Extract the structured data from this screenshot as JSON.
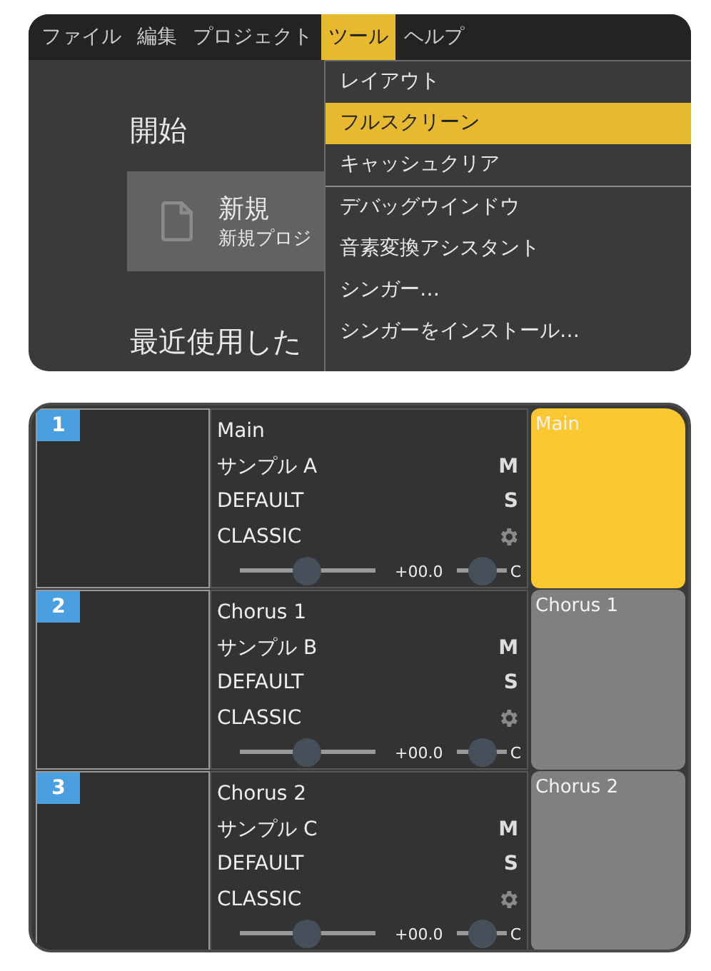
{
  "menu_bar": [
    {
      "label": "ファイル",
      "selected": false
    },
    {
      "label": "編集",
      "selected": false
    },
    {
      "label": "プロジェクト",
      "selected": false
    },
    {
      "label": "ツール",
      "selected": true
    },
    {
      "label": "ヘルプ",
      "selected": false
    }
  ],
  "start": {
    "heading": "開始",
    "new_card": {
      "title": "新規",
      "subtitle": "新規プロジ"
    },
    "recent_heading": "最近使用した"
  },
  "dropdown": [
    {
      "label": "レイアウト",
      "selected": false,
      "divider_after": false
    },
    {
      "label": "フルスクリーン",
      "selected": true,
      "divider_after": false
    },
    {
      "label": "キャッシュクリア",
      "selected": false,
      "divider_after": true
    },
    {
      "label": "デバッグウインドウ",
      "selected": false,
      "divider_after": false
    },
    {
      "label": "音素変換アシスタント",
      "selected": false,
      "divider_after": false
    },
    {
      "label": "シンガー…",
      "selected": false,
      "divider_after": false
    },
    {
      "label": "シンガーをインストール…",
      "selected": false,
      "divider_after": false
    }
  ],
  "tracks": [
    {
      "number": "1",
      "name": "Main",
      "singer": "サンプル A",
      "phonemizer": "DEFAULT",
      "renderer": "CLASSIC",
      "mute": "M",
      "solo": "S",
      "volume": {
        "level": 0.5,
        "reading": "+00.0"
      },
      "pan": {
        "level": 0.5,
        "reading": "C"
      },
      "part": "Main",
      "selected": true
    },
    {
      "number": "2",
      "name": "Chorus 1",
      "singer": "サンプル B",
      "phonemizer": "DEFAULT",
      "renderer": "CLASSIC",
      "mute": "M",
      "solo": "S",
      "volume": {
        "level": 0.5,
        "reading": "+00.0"
      },
      "pan": {
        "level": 0.5,
        "reading": "C"
      },
      "part": "Chorus 1",
      "selected": false
    },
    {
      "number": "3",
      "name": "Chorus 2",
      "singer": "サンプル C",
      "phonemizer": "DEFAULT",
      "renderer": "CLASSIC",
      "mute": "M",
      "solo": "S",
      "volume": {
        "level": 0.5,
        "reading": "+00.0"
      },
      "pan": {
        "level": 0.5,
        "reading": "C"
      },
      "part": "Chorus 2",
      "selected": false
    }
  ]
}
